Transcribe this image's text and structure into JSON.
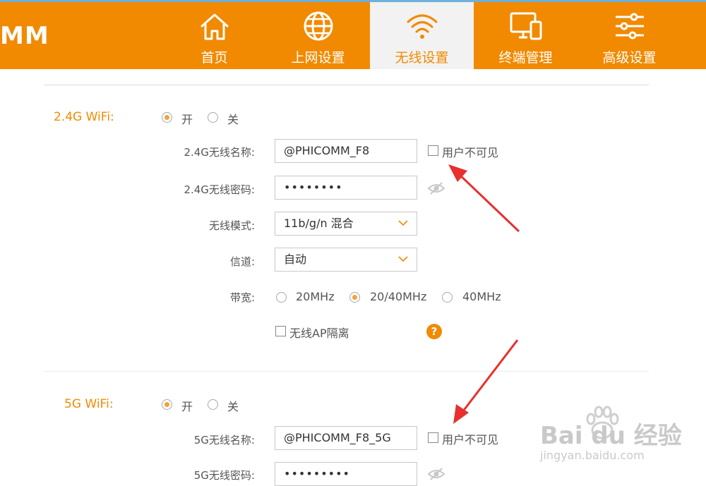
{
  "logo_text": "MM",
  "nav": [
    {
      "label": "首页",
      "icon": "home-icon"
    },
    {
      "label": "上网设置",
      "icon": "globe-icon"
    },
    {
      "label": "无线设置",
      "icon": "wifi-icon",
      "active": true
    },
    {
      "label": "终端管理",
      "icon": "devices-icon"
    },
    {
      "label": "高级设置",
      "icon": "sliders-icon"
    }
  ],
  "wifi24": {
    "section_label": "2.4G WiFi:",
    "on_label": "开",
    "off_label": "关",
    "state": "on",
    "name_label": "2.4G无线名称:",
    "name_value": "@PHICOMM_F8",
    "hide_label": "用户不可见",
    "password_label": "2.4G无线密码:",
    "password_value": "••••••••",
    "mode_label": "无线模式:",
    "mode_value": "11b/g/n 混合",
    "channel_label": "信道:",
    "channel_value": "自动",
    "bandwidth_label": "带宽:",
    "bandwidth_options": [
      "20MHz",
      "20/40MHz",
      "40MHz"
    ],
    "bandwidth_selected": "20/40MHz",
    "ap_isolation_label": "无线AP隔离",
    "help_text": "?"
  },
  "wifi5": {
    "section_label": "5G WiFi:",
    "on_label": "开",
    "off_label": "关",
    "state": "on",
    "name_label": "5G无线名称:",
    "name_value": "@PHICOMM_F8_5G",
    "hide_label": "用户不可见",
    "password_label": "5G无线密码:",
    "password_value": "•••••••••"
  },
  "watermark": {
    "brand": "Bai du 经验",
    "url": "jingyan.baidu.com"
  },
  "colors": {
    "header": "#f18a00",
    "accent": "#f18a00",
    "arrow": "#e8302e"
  }
}
